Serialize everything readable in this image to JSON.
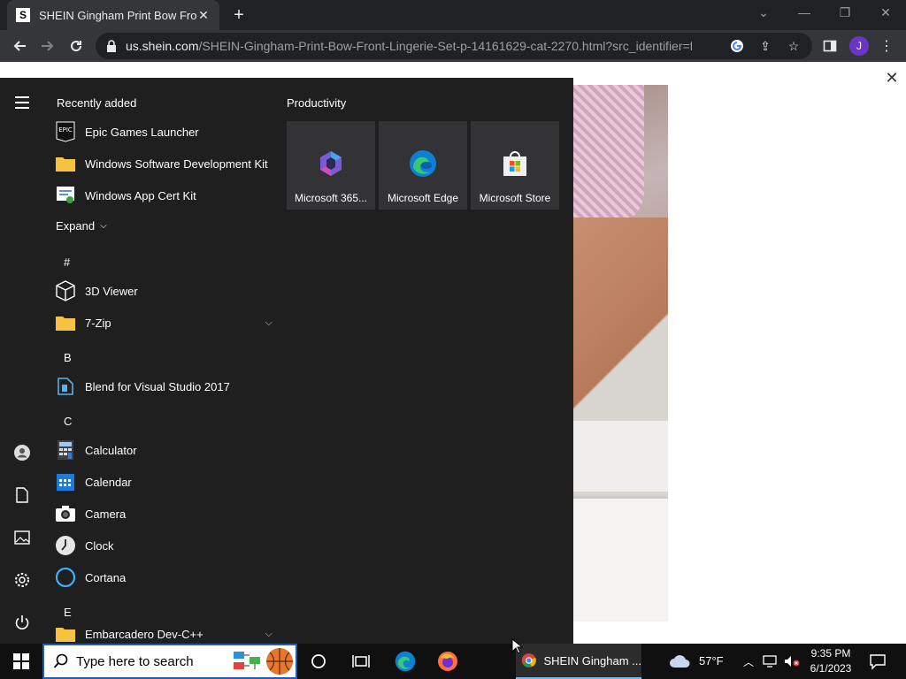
{
  "browser": {
    "tab_title": "SHEIN Gingham Print Bow Front",
    "tab_favicon_letter": "S",
    "url_host": "us.shein.com",
    "url_path": "/SHEIN-Gingham-Print-Bow-Front-Lingerie-Set-p-14161629-cat-2270.html?src_identifier=fc%...",
    "profile_initial": "J"
  },
  "start_menu": {
    "recently_added_title": "Recently added",
    "recently_added": [
      {
        "label": "Epic Games Launcher",
        "icon": "epic-games-icon"
      },
      {
        "label": "Windows Software Development Kit",
        "icon": "folder-icon"
      },
      {
        "label": "Windows App Cert Kit",
        "icon": "cert-kit-icon"
      }
    ],
    "expand_label": "Expand",
    "groups": {
      "hash": "#",
      "b": "B",
      "c": "C",
      "e": "E"
    },
    "apps": {
      "viewer3d": "3D Viewer",
      "zip": "7-Zip",
      "blend": "Blend for Visual Studio 2017",
      "calculator": "Calculator",
      "calendar": "Calendar",
      "camera": "Camera",
      "clock": "Clock",
      "cortana": "Cortana",
      "embarcadero": "Embarcadero Dev-C++"
    },
    "productivity_title": "Productivity",
    "tiles": [
      {
        "label": "Microsoft 365...",
        "icon": "microsoft-365-icon"
      },
      {
        "label": "Microsoft Edge",
        "icon": "edge-icon"
      },
      {
        "label": "Microsoft Store",
        "icon": "store-icon"
      }
    ]
  },
  "taskbar": {
    "search_placeholder": "Type here to search",
    "active_app_label": "SHEIN Gingham ...",
    "weather_temp": "57°F",
    "time": "9:35 PM",
    "date": "6/1/2023"
  }
}
